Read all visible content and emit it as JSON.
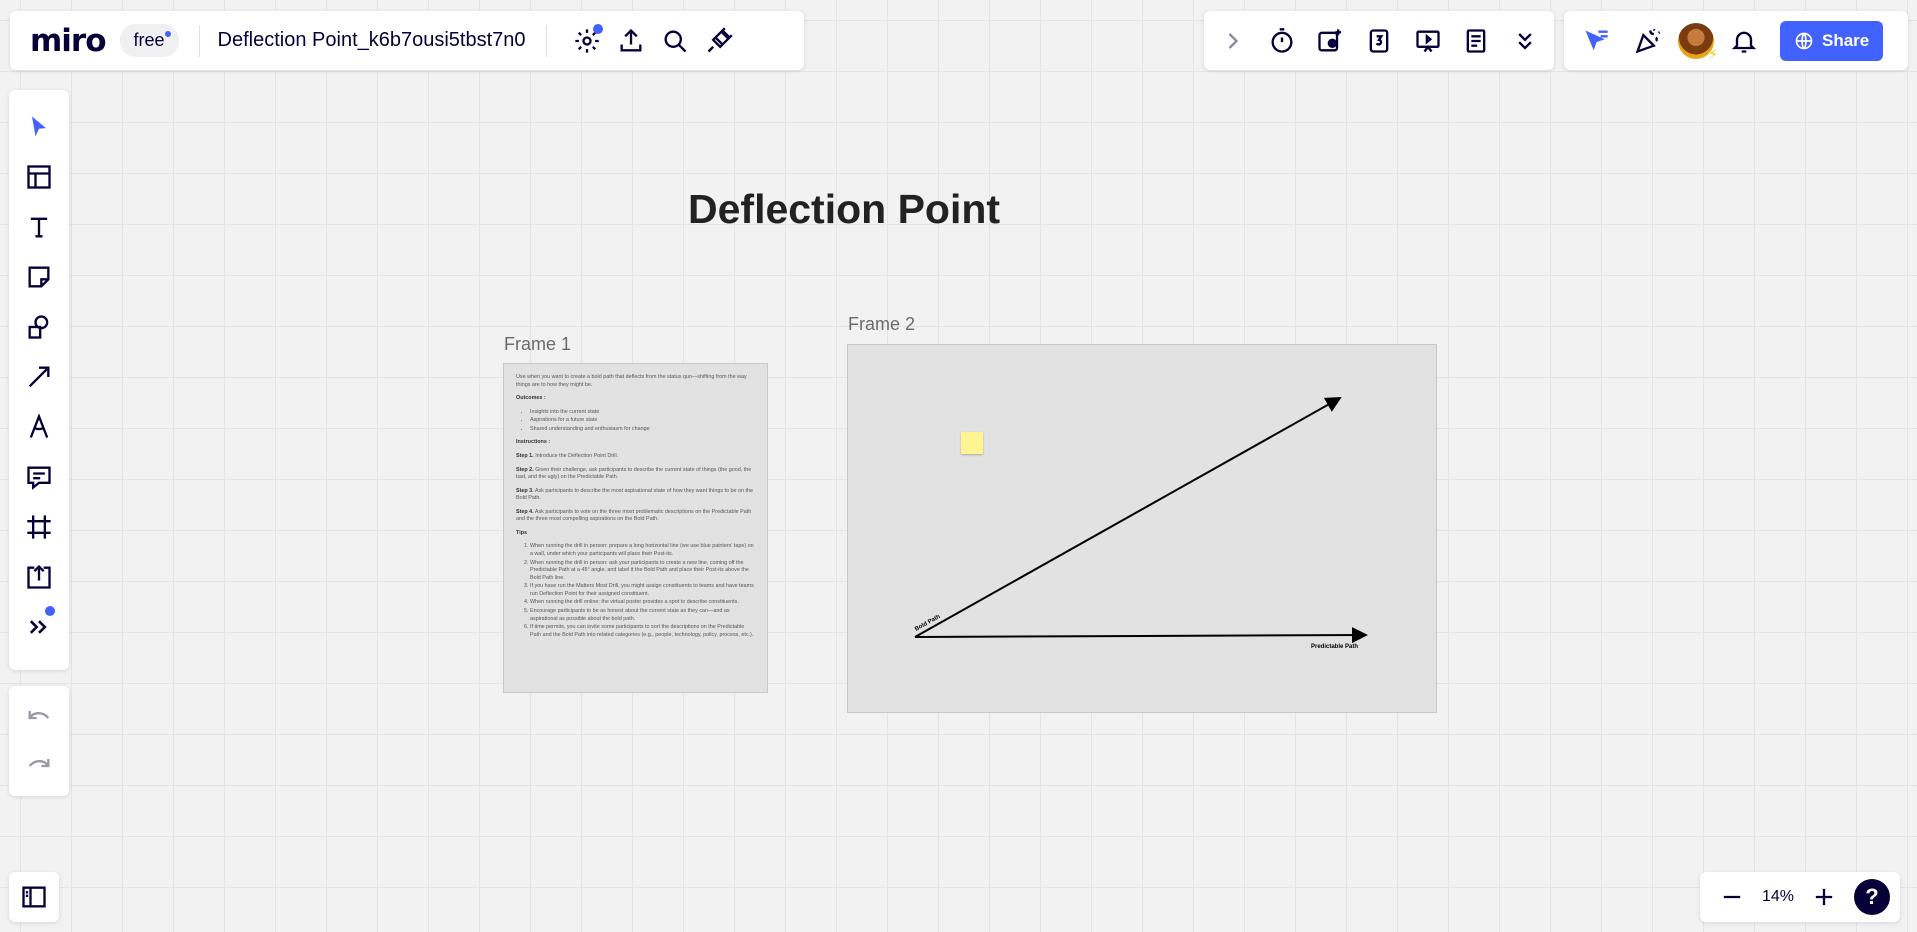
{
  "app": {
    "logo": "miro",
    "plan": "free"
  },
  "board": {
    "title": "Deflection Point_k6b7ousi5tbst7n0"
  },
  "zoom": {
    "level": "14%"
  },
  "share": {
    "label": "Share"
  },
  "canvas": {
    "heading": "Deflection Point",
    "frame1": {
      "label": "Frame 1",
      "intro": "Use when you want to create a bold path that deflects from the status quo—shifting from the way things are to how they might be.",
      "outcomes_title": "Outcomes :",
      "outcomes": [
        "Insights into the current state",
        "Aspirations for a future state",
        "Shared understanding and enthusiasm for change"
      ],
      "instructions_title": "Instructions :",
      "steps": [
        {
          "label": "Step 1.",
          "text": "Introduce the Deflection Point Drill."
        },
        {
          "label": "Step 2.",
          "text": "Given their challenge, ask participants to describe the current state of things (the good, the bad, and the ugly) on the Predictable Path."
        },
        {
          "label": "Step 3.",
          "text": "Ask participants to describe the most aspirational state of how they want things to be on the Bold Path."
        },
        {
          "label": "Step 4.",
          "text": "Ask participants to vote on the three most problematic descriptions on the Predictable Path and the three most compelling aspirations on the Bold Path."
        }
      ],
      "tips_title": "Tips",
      "tips": [
        "When running the drill in person: prepare a long horizontal line (we use blue painters' tape) on a wall, under which your participants will place their Post-its.",
        "When running the drill in person: ask your participants to create a new line, coming off the Predictable Path at a 45° angle, and label it the Bold Path and place their Post-its above the Bold Path line.",
        "If you have run the Matters Most Drill, you might assign constituents to teams and have teams run Deflection Point for their assigned constituent.",
        "When running the drill online: the virtual poster provides a spot to describe constituents.",
        "Encourage participants to be as honest about the current state as they can—and as aspirational as possible about the bold path.",
        "If time permits, you can invite some participants to sort the descriptions on the Predictable Path and the Bold Path into related categories (e.g., people, technology, policy, process, etc.)."
      ]
    },
    "frame2": {
      "label": "Frame 2",
      "bold_path_label": "Bold Path",
      "predictable_path_label": "Predictable Path"
    }
  },
  "colors": {
    "accent": "#4262ff",
    "brand_dark": "#050038",
    "sticky": "#fff48f"
  }
}
